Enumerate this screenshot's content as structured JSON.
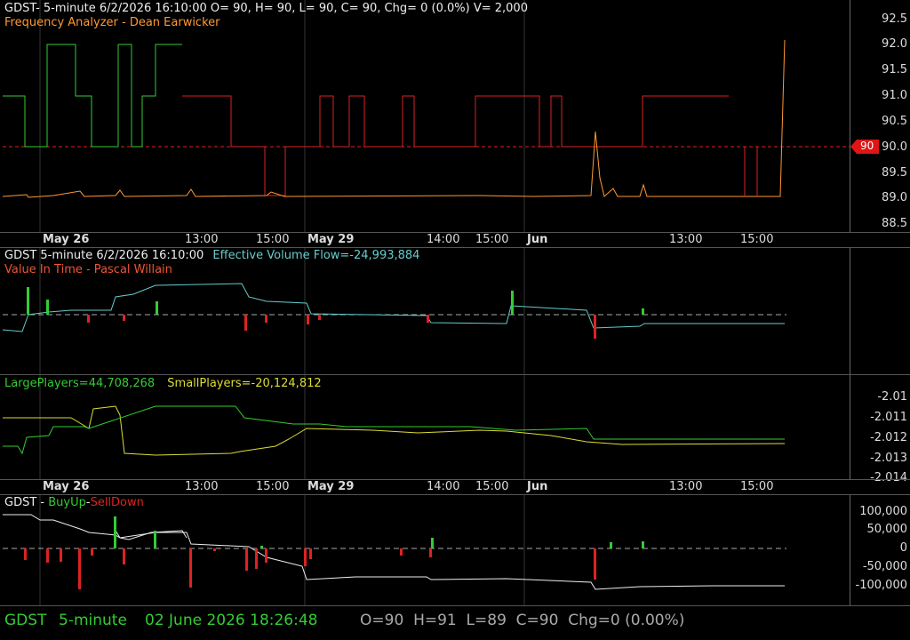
{
  "colors": {
    "green": "#33cc33",
    "red": "#dd2222",
    "orange": "#ff9933",
    "yellow": "#dddd33",
    "cyan": "#66cccc",
    "white": "#eeeeee",
    "grid": "#333333"
  },
  "pane1": {
    "header1": "GDST- 5-minute 6/2/2026 16:10:00 O= 90, H= 90, L= 90, C= 90, Chg= 0 (0.0%) V= 2,000",
    "header2": "Frequency Analyzer - Dean Earwicker",
    "yaxis": [
      "92.5",
      "92.0",
      "91.5",
      "91.0",
      "90.5",
      "90.0",
      "89.5",
      "89.0",
      "88.5"
    ],
    "last_price_tag": "90"
  },
  "xaxis": {
    "labels": [
      {
        "text": "May 26",
        "bold": true
      },
      {
        "text": "13:00",
        "bold": false
      },
      {
        "text": "15:00",
        "bold": false
      },
      {
        "text": "May 29",
        "bold": true
      },
      {
        "text": "14:00",
        "bold": false
      },
      {
        "text": "15:00",
        "bold": false
      },
      {
        "text": "Jun",
        "bold": true
      },
      {
        "text": "13:00",
        "bold": false
      },
      {
        "text": "15:00",
        "bold": false
      }
    ]
  },
  "pane2": {
    "header_left": "GDST 5-minute  6/2/2026 16:10:00",
    "header_right": "Effective Volume Flow=-24,993,884",
    "header2": "Value In Time - Pascal Willain"
  },
  "pane3": {
    "large": "LargePlayers=44,708,268",
    "small": "SmallPlayers=-20,124,812",
    "yaxis": [
      "-2.01",
      "-2.011",
      "-2.012",
      "-2.013",
      "-2.014"
    ]
  },
  "pane4": {
    "prefix": "GDST - ",
    "buyup": "BuyUp",
    "dash": "-",
    "selldown": "SellDown",
    "yaxis": [
      "100,000",
      "50,000",
      "0",
      "-50,000",
      "-100,000"
    ]
  },
  "status": {
    "symbol": "GDST",
    "interval": "5-minute",
    "datetime": "02 June 2026 18:26:48",
    "ohlc": "O=90  H=91  L=89  C=90  Chg=0 (0.00%)"
  }
}
